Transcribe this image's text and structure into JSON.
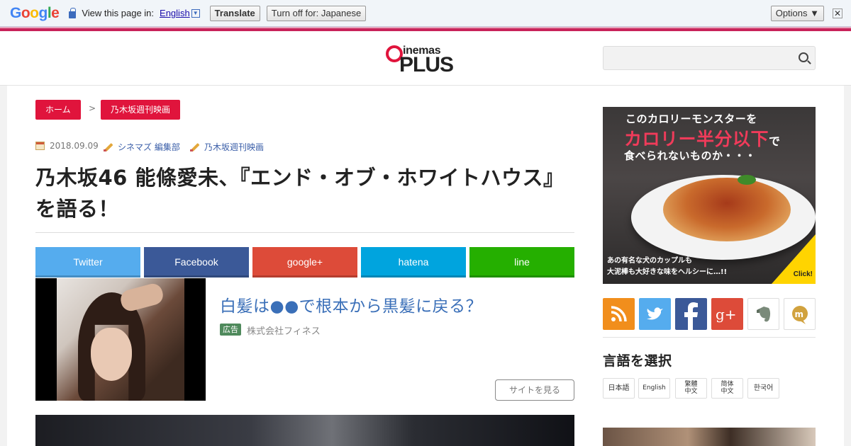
{
  "translate_bar": {
    "logo_letters": [
      {
        "ch": "G",
        "color": "#4285f4"
      },
      {
        "ch": "o",
        "color": "#ea4335"
      },
      {
        "ch": "o",
        "color": "#fbbc05"
      },
      {
        "ch": "g",
        "color": "#4285f4"
      },
      {
        "ch": "l",
        "color": "#34a853"
      },
      {
        "ch": "e",
        "color": "#ea4335"
      }
    ],
    "prompt": "View this page in:",
    "language": "English",
    "select_glyph": "▼",
    "translate_label": "Translate",
    "turn_off_label": "Turn off for: Japanese",
    "options_label": "Options ▼",
    "close_glyph": "✕"
  },
  "header": {
    "logo_word": "inemas",
    "logo_plus": "PLUS",
    "search_placeholder": ""
  },
  "breadcrumb": {
    "home": "ホーム",
    "separator": ">",
    "category": "乃木坂週刊映画"
  },
  "meta": {
    "date": "2018.09.09",
    "author": "シネマズ 編集部",
    "category": "乃木坂週刊映画"
  },
  "article": {
    "title": "乃木坂46 能條愛未、『エンド・オブ・ホワイトハウス』を語る！"
  },
  "share_buttons": [
    {
      "label": "Twitter",
      "color": "#55acee"
    },
    {
      "label": "Facebook",
      "color": "#3b5998"
    },
    {
      "label": "google+",
      "color": "#dd4b39"
    },
    {
      "label": "hatena",
      "color": "#00a4de"
    },
    {
      "label": "line",
      "color": "#25af00"
    }
  ],
  "ad": {
    "title": "白髪は●●で根本から黒髪に戻る？",
    "badge": "広告",
    "sponsor": "株式会社フィネス",
    "button": "サイトを見る"
  },
  "banner": {
    "line1": "このカロリーモンスターを",
    "line2_main": "カロリー半分以下",
    "line2_tail": "で",
    "line3": "食べられないものか・・・",
    "line4": "あの有名な犬のカップルも",
    "line5": "大泥棒も大好きな味をヘルシーに…!!",
    "click": "Click!"
  },
  "social_icons": [
    {
      "name": "rss-icon",
      "color": "#f18e1c"
    },
    {
      "name": "twitter-icon",
      "color": "#55acee"
    },
    {
      "name": "facebook-icon",
      "color": "#3b5998"
    },
    {
      "name": "google-plus-icon",
      "color": "#dd4b39"
    },
    {
      "name": "evernote-icon",
      "color": "#ffffff"
    },
    {
      "name": "mixi-check-icon",
      "color": "#ffffff"
    }
  ],
  "language_select": {
    "title": "言語を選択",
    "options": [
      "日本語",
      "English",
      "繁體中文",
      "简体中文",
      "한국어"
    ]
  }
}
